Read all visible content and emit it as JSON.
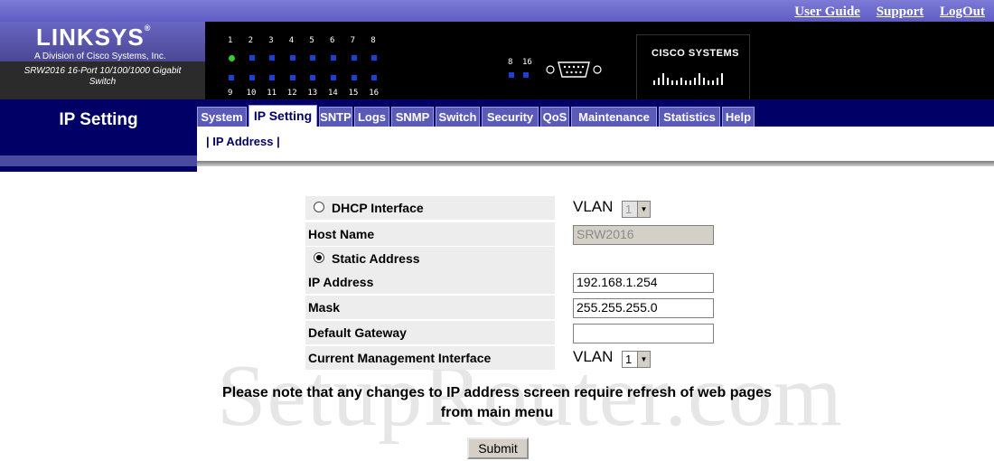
{
  "toplinks": {
    "user_guide": "User Guide",
    "support": "Support",
    "logout": "LogOut"
  },
  "brand": {
    "logo": "LINKSYS",
    "sub": "A Division of Cisco Systems, Inc.",
    "model_line1": "SRW2016 16-Port 10/100/1000 Gigabit",
    "model_line2": "Switch",
    "cisco": "CISCO SYSTEMS"
  },
  "ports": {
    "top": [
      "1",
      "2",
      "3",
      "4",
      "5",
      "6",
      "7",
      "8"
    ],
    "bottom": [
      "9",
      "10",
      "11",
      "12",
      "13",
      "14",
      "15",
      "16"
    ],
    "uplink": [
      "8",
      "16"
    ]
  },
  "page": {
    "title": "IP Setting"
  },
  "tabs": [
    {
      "label": "System"
    },
    {
      "label": "IP Setting",
      "active": true
    },
    {
      "label": "SNTP"
    },
    {
      "label": "Logs"
    },
    {
      "label": "SNMP"
    },
    {
      "label": "Switch"
    },
    {
      "label": "Security"
    },
    {
      "label": "QoS"
    },
    {
      "label": "Maintenance"
    },
    {
      "label": "Statistics"
    },
    {
      "label": "Help"
    }
  ],
  "sublinks": {
    "ip_address": "IP Address"
  },
  "form": {
    "dhcp_label": "DHCP Interface",
    "dhcp_vlan_label": "VLAN",
    "dhcp_vlan_value": "1",
    "host_name_label": "Host Name",
    "host_name_value": "SRW2016",
    "static_label": "Static Address",
    "ip_label": "IP Address",
    "ip_value": "192.168.1.254",
    "mask_label": "Mask",
    "mask_value": "255.255.255.0",
    "gateway_label": "Default Gateway",
    "gateway_value": "",
    "mgmt_label": "Current Management Interface",
    "mgmt_vlan_label": "VLAN",
    "mgmt_vlan_value": "1",
    "selected_mode": "Static Address"
  },
  "note": "Please note that any changes to IP address screen require refresh of web pages from main menu",
  "submit_label": "Submit",
  "watermark": "SetupRouter.com"
}
